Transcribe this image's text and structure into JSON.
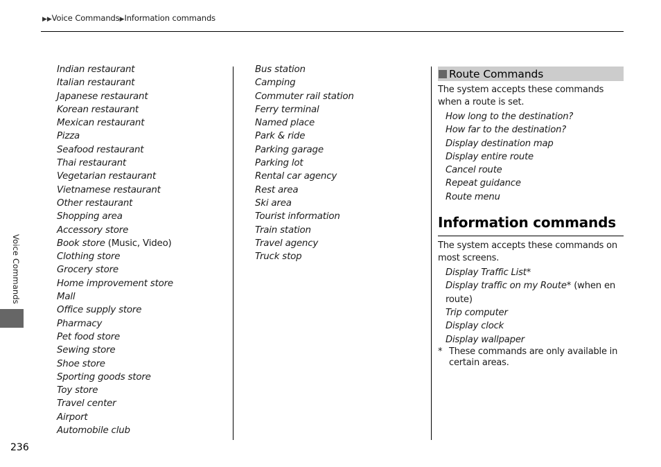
{
  "breadcrumb": {
    "prefix_arrows": "▶▶",
    "items": [
      "Voice Commands",
      "Information commands"
    ],
    "separator": "▶"
  },
  "side_tab": {
    "label": "Voice Commands",
    "block_color": "#666666"
  },
  "page_number": "236",
  "column1": {
    "items": [
      {
        "text": "Indian restaurant"
      },
      {
        "text": "Italian restaurant"
      },
      {
        "text": "Japanese restaurant"
      },
      {
        "text": "Korean restaurant"
      },
      {
        "text": "Mexican restaurant"
      },
      {
        "text": "Pizza"
      },
      {
        "text": "Seafood restaurant"
      },
      {
        "text": "Thai restaurant"
      },
      {
        "text": "Vegetarian restaurant"
      },
      {
        "text": "Vietnamese restaurant"
      },
      {
        "text": "Other restaurant"
      },
      {
        "text": "Shopping area"
      },
      {
        "text": "Accessory store"
      },
      {
        "text": "Book store",
        "note": " (Music, Video)"
      },
      {
        "text": "Clothing store"
      },
      {
        "text": "Grocery store"
      },
      {
        "text": "Home improvement store"
      },
      {
        "text": "Mall"
      },
      {
        "text": "Office supply store"
      },
      {
        "text": "Pharmacy"
      },
      {
        "text": "Pet food store"
      },
      {
        "text": "Sewing store"
      },
      {
        "text": "Shoe store"
      },
      {
        "text": "Sporting goods store"
      },
      {
        "text": "Toy store"
      },
      {
        "text": "Travel center"
      },
      {
        "text": "Airport"
      },
      {
        "text": "Automobile club"
      }
    ]
  },
  "column2": {
    "items": [
      {
        "text": "Bus station"
      },
      {
        "text": "Camping"
      },
      {
        "text": "Commuter rail station"
      },
      {
        "text": "Ferry terminal"
      },
      {
        "text": "Named place"
      },
      {
        "text": "Park & ride"
      },
      {
        "text": "Parking garage"
      },
      {
        "text": "Parking lot"
      },
      {
        "text": "Rental car agency"
      },
      {
        "text": "Rest area"
      },
      {
        "text": "Ski area"
      },
      {
        "text": "Tourist information"
      },
      {
        "text": "Train station"
      },
      {
        "text": "Travel agency"
      },
      {
        "text": "Truck stop"
      }
    ]
  },
  "route_commands": {
    "heading": "Route Commands",
    "header_bg": "#cccccc",
    "intro": "The system accepts these commands when a route is set.",
    "commands": [
      "How long to the destination?",
      "How far to the destination?",
      "Display destination map",
      "Display entire route",
      "Cancel route",
      "Repeat guidance",
      "Route menu"
    ]
  },
  "information_commands": {
    "title": "Information commands",
    "intro": "The system accepts these commands on most screens.",
    "commands": [
      {
        "text": "Display Traffic List*"
      },
      {
        "text": "Display traffic on my Route*",
        "note": " (when en route)"
      },
      {
        "text": "Trip computer"
      },
      {
        "text": "Display clock"
      },
      {
        "text": "Display wallpaper"
      }
    ],
    "footnote_marker": "*",
    "footnote": "These commands are only available in certain areas."
  }
}
